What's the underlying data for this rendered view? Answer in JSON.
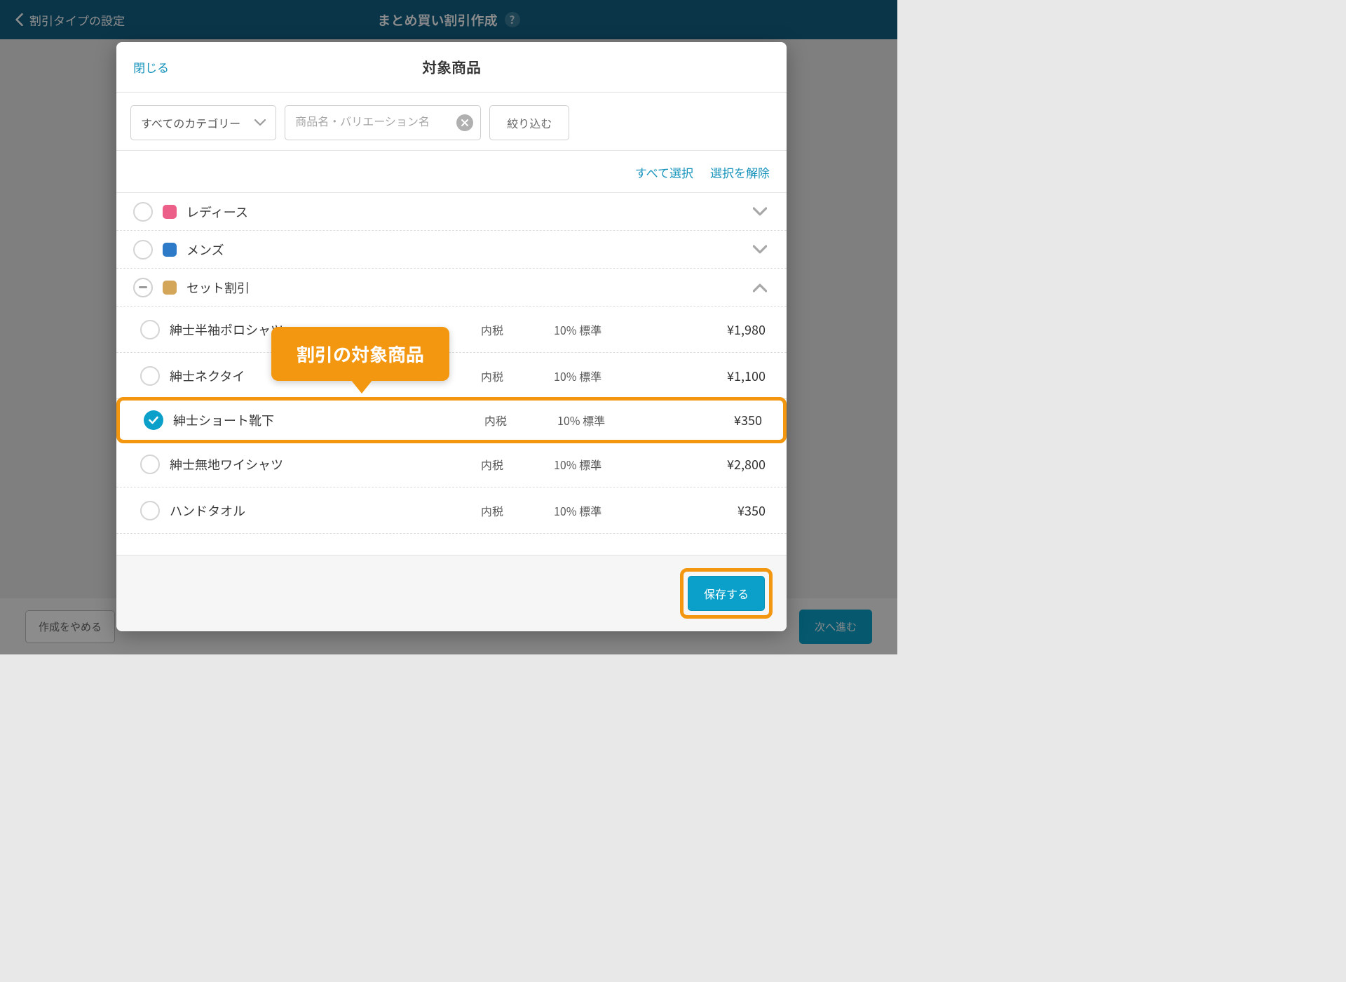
{
  "header": {
    "back_label": "割引タイプの設定",
    "title": "まとめ買い割引作成"
  },
  "footer": {
    "cancel_label": "作成をやめる",
    "next_label": "次へ進む"
  },
  "modal": {
    "close_label": "閉じる",
    "title": "対象商品",
    "category_select": "すべてのカテゴリー",
    "search_placeholder": "商品名・バリエーション名",
    "filter_label": "絞り込む",
    "select_all_label": "すべて選択",
    "deselect_label": "選択を解除",
    "save_label": "保存する"
  },
  "callout": "割引の対象商品",
  "categories": [
    {
      "name": "レディース",
      "color": "#ec5f89",
      "state": "unchecked",
      "expanded": false
    },
    {
      "name": "メンズ",
      "color": "#2d7ac9",
      "state": "unchecked",
      "expanded": false
    },
    {
      "name": "セット割引",
      "color": "#d3a65a",
      "state": "partial",
      "expanded": true
    }
  ],
  "products": [
    {
      "name": "紳士半袖ポロシャツ",
      "tax": "内税",
      "rate": "10% 標準",
      "price": "¥1,980",
      "checked": false
    },
    {
      "name": "紳士ネクタイ",
      "tax": "内税",
      "rate": "10% 標準",
      "price": "¥1,100",
      "checked": false
    },
    {
      "name": "紳士ショート靴下",
      "tax": "内税",
      "rate": "10% 標準",
      "price": "¥350",
      "checked": true
    },
    {
      "name": "紳士無地ワイシャツ",
      "tax": "内税",
      "rate": "10% 標準",
      "price": "¥2,800",
      "checked": false
    },
    {
      "name": "ハンドタオル",
      "tax": "内税",
      "rate": "10% 標準",
      "price": "¥350",
      "checked": false
    }
  ]
}
